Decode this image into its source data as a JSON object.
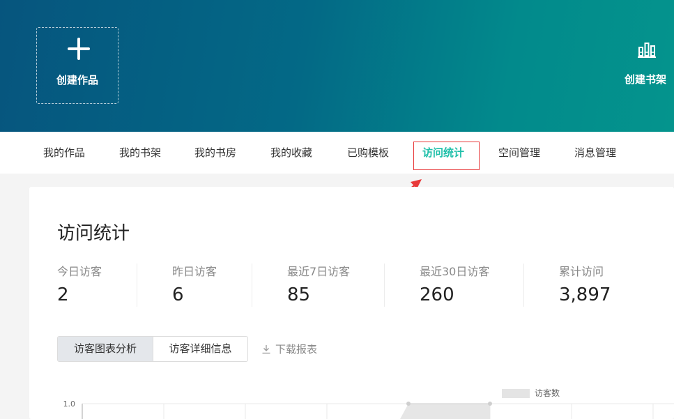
{
  "header": {
    "create_work_label": "创建作品",
    "create_shelf_label": "创建书架"
  },
  "tabs": [
    {
      "label": "我的作品"
    },
    {
      "label": "我的书架"
    },
    {
      "label": "我的书房"
    },
    {
      "label": "我的收藏"
    },
    {
      "label": "已购模板"
    },
    {
      "label": "访问统计",
      "active": true
    },
    {
      "label": "空间管理"
    },
    {
      "label": "消息管理"
    }
  ],
  "stats_card": {
    "title": "访问统计",
    "stats": [
      {
        "label": "今日访客",
        "value": "2"
      },
      {
        "label": "昨日访客",
        "value": "6"
      },
      {
        "label": "最近7日访客",
        "value": "85"
      },
      {
        "label": "最近30日访客",
        "value": "260"
      },
      {
        "label": "累计访问",
        "value": "3,897"
      }
    ],
    "view_buttons": [
      {
        "label": "访客图表分析",
        "active": true
      },
      {
        "label": "访客详细信息",
        "active": false
      }
    ],
    "download_label": "下载报表"
  },
  "chart_data": {
    "type": "area",
    "series": [
      {
        "name": "访客数"
      }
    ],
    "y_tick_labels": [
      "1.0"
    ]
  },
  "colors": {
    "header_gradient_start": "#06557e",
    "header_gradient_end": "#04948d",
    "active_tab": "#1fbfa9",
    "highlight_box": "#e8393a",
    "annotation_arrow": "#e8393a"
  },
  "icons": {
    "create_work": "plus-icon",
    "create_shelf": "bookshelf-icon",
    "download": "download-icon"
  }
}
